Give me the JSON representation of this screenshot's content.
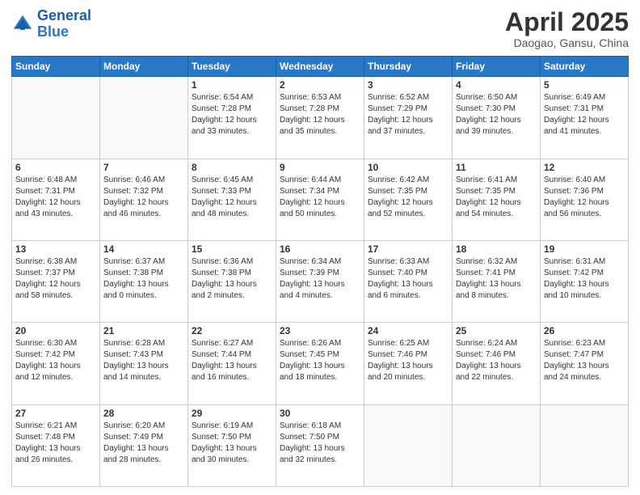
{
  "logo": {
    "line1": "General",
    "line2": "Blue"
  },
  "title": "April 2025",
  "subtitle": "Daogao, Gansu, China",
  "weekdays": [
    "Sunday",
    "Monday",
    "Tuesday",
    "Wednesday",
    "Thursday",
    "Friday",
    "Saturday"
  ],
  "weeks": [
    [
      {
        "day": "",
        "sunrise": "",
        "sunset": "",
        "daylight": ""
      },
      {
        "day": "",
        "sunrise": "",
        "sunset": "",
        "daylight": ""
      },
      {
        "day": "1",
        "sunrise": "Sunrise: 6:54 AM",
        "sunset": "Sunset: 7:28 PM",
        "daylight": "Daylight: 12 hours and 33 minutes."
      },
      {
        "day": "2",
        "sunrise": "Sunrise: 6:53 AM",
        "sunset": "Sunset: 7:28 PM",
        "daylight": "Daylight: 12 hours and 35 minutes."
      },
      {
        "day": "3",
        "sunrise": "Sunrise: 6:52 AM",
        "sunset": "Sunset: 7:29 PM",
        "daylight": "Daylight: 12 hours and 37 minutes."
      },
      {
        "day": "4",
        "sunrise": "Sunrise: 6:50 AM",
        "sunset": "Sunset: 7:30 PM",
        "daylight": "Daylight: 12 hours and 39 minutes."
      },
      {
        "day": "5",
        "sunrise": "Sunrise: 6:49 AM",
        "sunset": "Sunset: 7:31 PM",
        "daylight": "Daylight: 12 hours and 41 minutes."
      }
    ],
    [
      {
        "day": "6",
        "sunrise": "Sunrise: 6:48 AM",
        "sunset": "Sunset: 7:31 PM",
        "daylight": "Daylight: 12 hours and 43 minutes."
      },
      {
        "day": "7",
        "sunrise": "Sunrise: 6:46 AM",
        "sunset": "Sunset: 7:32 PM",
        "daylight": "Daylight: 12 hours and 46 minutes."
      },
      {
        "day": "8",
        "sunrise": "Sunrise: 6:45 AM",
        "sunset": "Sunset: 7:33 PM",
        "daylight": "Daylight: 12 hours and 48 minutes."
      },
      {
        "day": "9",
        "sunrise": "Sunrise: 6:44 AM",
        "sunset": "Sunset: 7:34 PM",
        "daylight": "Daylight: 12 hours and 50 minutes."
      },
      {
        "day": "10",
        "sunrise": "Sunrise: 6:42 AM",
        "sunset": "Sunset: 7:35 PM",
        "daylight": "Daylight: 12 hours and 52 minutes."
      },
      {
        "day": "11",
        "sunrise": "Sunrise: 6:41 AM",
        "sunset": "Sunset: 7:35 PM",
        "daylight": "Daylight: 12 hours and 54 minutes."
      },
      {
        "day": "12",
        "sunrise": "Sunrise: 6:40 AM",
        "sunset": "Sunset: 7:36 PM",
        "daylight": "Daylight: 12 hours and 56 minutes."
      }
    ],
    [
      {
        "day": "13",
        "sunrise": "Sunrise: 6:38 AM",
        "sunset": "Sunset: 7:37 PM",
        "daylight": "Daylight: 12 hours and 58 minutes."
      },
      {
        "day": "14",
        "sunrise": "Sunrise: 6:37 AM",
        "sunset": "Sunset: 7:38 PM",
        "daylight": "Daylight: 13 hours and 0 minutes."
      },
      {
        "day": "15",
        "sunrise": "Sunrise: 6:36 AM",
        "sunset": "Sunset: 7:38 PM",
        "daylight": "Daylight: 13 hours and 2 minutes."
      },
      {
        "day": "16",
        "sunrise": "Sunrise: 6:34 AM",
        "sunset": "Sunset: 7:39 PM",
        "daylight": "Daylight: 13 hours and 4 minutes."
      },
      {
        "day": "17",
        "sunrise": "Sunrise: 6:33 AM",
        "sunset": "Sunset: 7:40 PM",
        "daylight": "Daylight: 13 hours and 6 minutes."
      },
      {
        "day": "18",
        "sunrise": "Sunrise: 6:32 AM",
        "sunset": "Sunset: 7:41 PM",
        "daylight": "Daylight: 13 hours and 8 minutes."
      },
      {
        "day": "19",
        "sunrise": "Sunrise: 6:31 AM",
        "sunset": "Sunset: 7:42 PM",
        "daylight": "Daylight: 13 hours and 10 minutes."
      }
    ],
    [
      {
        "day": "20",
        "sunrise": "Sunrise: 6:30 AM",
        "sunset": "Sunset: 7:42 PM",
        "daylight": "Daylight: 13 hours and 12 minutes."
      },
      {
        "day": "21",
        "sunrise": "Sunrise: 6:28 AM",
        "sunset": "Sunset: 7:43 PM",
        "daylight": "Daylight: 13 hours and 14 minutes."
      },
      {
        "day": "22",
        "sunrise": "Sunrise: 6:27 AM",
        "sunset": "Sunset: 7:44 PM",
        "daylight": "Daylight: 13 hours and 16 minutes."
      },
      {
        "day": "23",
        "sunrise": "Sunrise: 6:26 AM",
        "sunset": "Sunset: 7:45 PM",
        "daylight": "Daylight: 13 hours and 18 minutes."
      },
      {
        "day": "24",
        "sunrise": "Sunrise: 6:25 AM",
        "sunset": "Sunset: 7:46 PM",
        "daylight": "Daylight: 13 hours and 20 minutes."
      },
      {
        "day": "25",
        "sunrise": "Sunrise: 6:24 AM",
        "sunset": "Sunset: 7:46 PM",
        "daylight": "Daylight: 13 hours and 22 minutes."
      },
      {
        "day": "26",
        "sunrise": "Sunrise: 6:23 AM",
        "sunset": "Sunset: 7:47 PM",
        "daylight": "Daylight: 13 hours and 24 minutes."
      }
    ],
    [
      {
        "day": "27",
        "sunrise": "Sunrise: 6:21 AM",
        "sunset": "Sunset: 7:48 PM",
        "daylight": "Daylight: 13 hours and 26 minutes."
      },
      {
        "day": "28",
        "sunrise": "Sunrise: 6:20 AM",
        "sunset": "Sunset: 7:49 PM",
        "daylight": "Daylight: 13 hours and 28 minutes."
      },
      {
        "day": "29",
        "sunrise": "Sunrise: 6:19 AM",
        "sunset": "Sunset: 7:50 PM",
        "daylight": "Daylight: 13 hours and 30 minutes."
      },
      {
        "day": "30",
        "sunrise": "Sunrise: 6:18 AM",
        "sunset": "Sunset: 7:50 PM",
        "daylight": "Daylight: 13 hours and 32 minutes."
      },
      {
        "day": "",
        "sunrise": "",
        "sunset": "",
        "daylight": ""
      },
      {
        "day": "",
        "sunrise": "",
        "sunset": "",
        "daylight": ""
      },
      {
        "day": "",
        "sunrise": "",
        "sunset": "",
        "daylight": ""
      }
    ]
  ]
}
